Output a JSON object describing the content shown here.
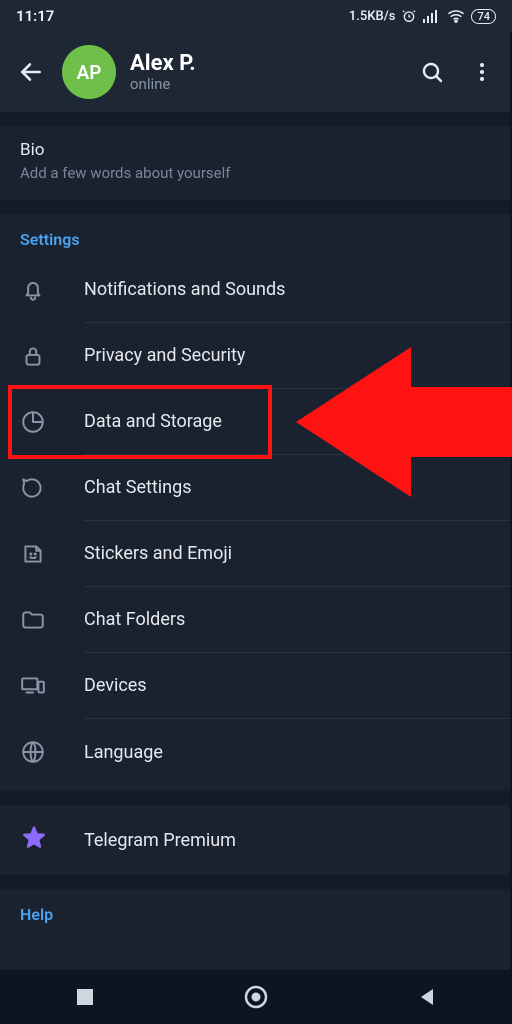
{
  "status_bar": {
    "time": "11:17",
    "speed": "1.5KB/s",
    "battery": "74"
  },
  "header": {
    "avatar_initials": "AP",
    "name": "Alex P.",
    "status": "online"
  },
  "bio": {
    "title": "Bio",
    "subtitle": "Add a few words about yourself"
  },
  "sections": {
    "settings_title": "Settings",
    "help_title": "Help"
  },
  "settings": {
    "items": [
      {
        "label": "Notifications and Sounds",
        "icon": "bell-icon"
      },
      {
        "label": "Privacy and Security",
        "icon": "lock-icon"
      },
      {
        "label": "Data and Storage",
        "icon": "piechart-icon"
      },
      {
        "label": "Chat Settings",
        "icon": "chat-icon"
      },
      {
        "label": "Stickers and Emoji",
        "icon": "sticker-icon"
      },
      {
        "label": "Chat Folders",
        "icon": "folder-icon"
      },
      {
        "label": "Devices",
        "icon": "devices-icon"
      },
      {
        "label": "Language",
        "icon": "globe-icon"
      }
    ]
  },
  "premium": {
    "label": "Telegram Premium"
  },
  "annotation": {
    "highlight_index": 2
  },
  "colors": {
    "accent_blue": "#4aa3f0",
    "avatar_green": "#6fbf4b",
    "arrow_red": "#ff1212",
    "premium_star": "#8d6bff"
  }
}
